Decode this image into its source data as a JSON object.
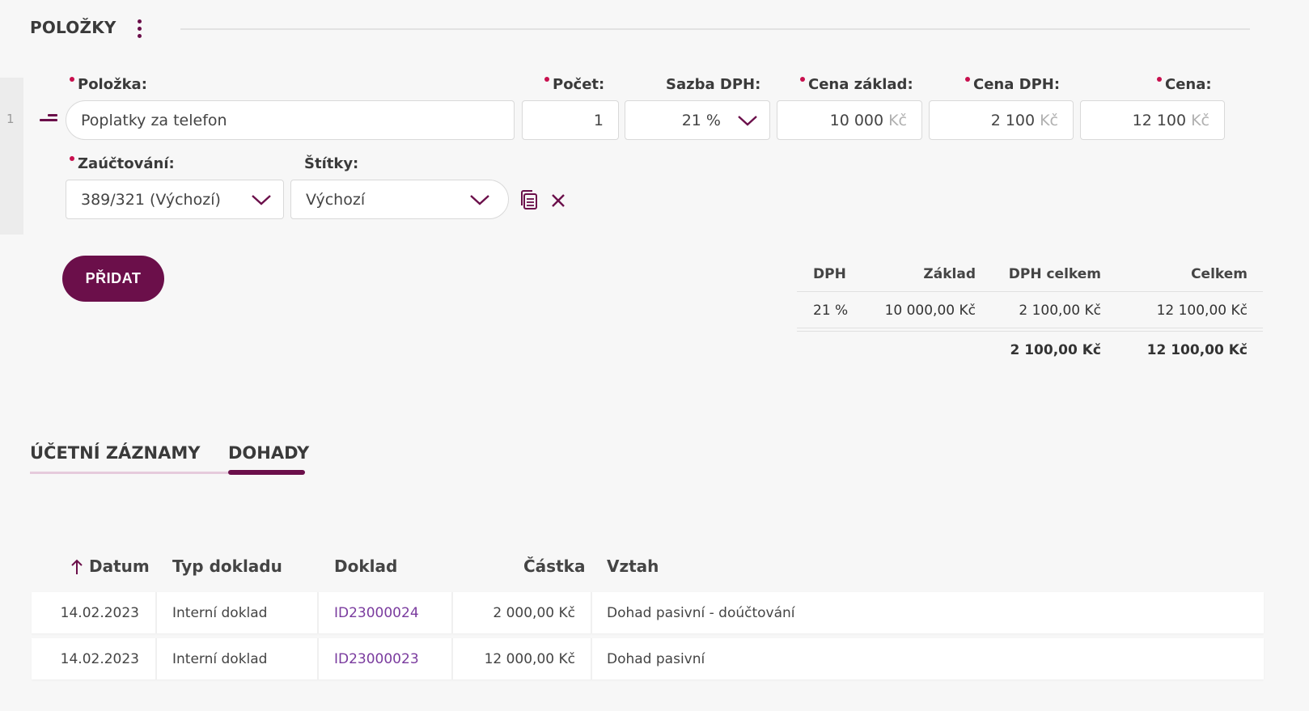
{
  "section": {
    "title": "POLOŽKY",
    "menu_icon": "more-vertical-icon"
  },
  "item_row": {
    "row_number": "1",
    "labels": {
      "item": "Položka:",
      "count": "Počet:",
      "vat_rate": "Sazba DPH:",
      "base_price": "Cena základ:",
      "vat_price": "Cena DPH:",
      "price": "Cena:",
      "accounting": "Zaúčtování:",
      "tags": "Štítky:"
    },
    "values": {
      "item": "Poplatky za telefon",
      "count": "1",
      "vat_rate": "21 %",
      "base_price": "10 000",
      "vat_price": "2 100",
      "price": "12 100",
      "currency": "Kč",
      "accounting": "389/321 (Výchozí)",
      "tags": "Výchozí"
    }
  },
  "add_button": "PŘIDAT",
  "vat_summary": {
    "headers": [
      "DPH",
      "Základ",
      "DPH celkem",
      "Celkem"
    ],
    "rows": [
      [
        "21 %",
        "10 000,00 Kč",
        "2 100,00 Kč",
        "12 100,00 Kč"
      ]
    ],
    "totals": [
      "",
      "",
      "2 100,00 Kč",
      "12 100,00 Kč"
    ]
  },
  "tabs": [
    {
      "label": "ÚČETNÍ ZÁZNAMY",
      "active": false
    },
    {
      "label": "DOHADY",
      "active": true
    }
  ],
  "table": {
    "sort_icon": "arrow-up-icon",
    "headers": [
      "Datum",
      "Typ dokladu",
      "Doklad",
      "Částka",
      "Vztah"
    ],
    "rows": [
      [
        "14.02.2023",
        "Interní doklad",
        "ID23000024",
        "2 000,00 Kč",
        "Dohad pasivní - doúčtování"
      ],
      [
        "14.02.2023",
        "Interní doklad",
        "ID23000023",
        "12 000,00 Kč",
        "Dohad pasivní"
      ]
    ]
  },
  "colors": {
    "accent": "#6b0f4a",
    "required": "#c8104e",
    "link": "#7a3b9e"
  }
}
